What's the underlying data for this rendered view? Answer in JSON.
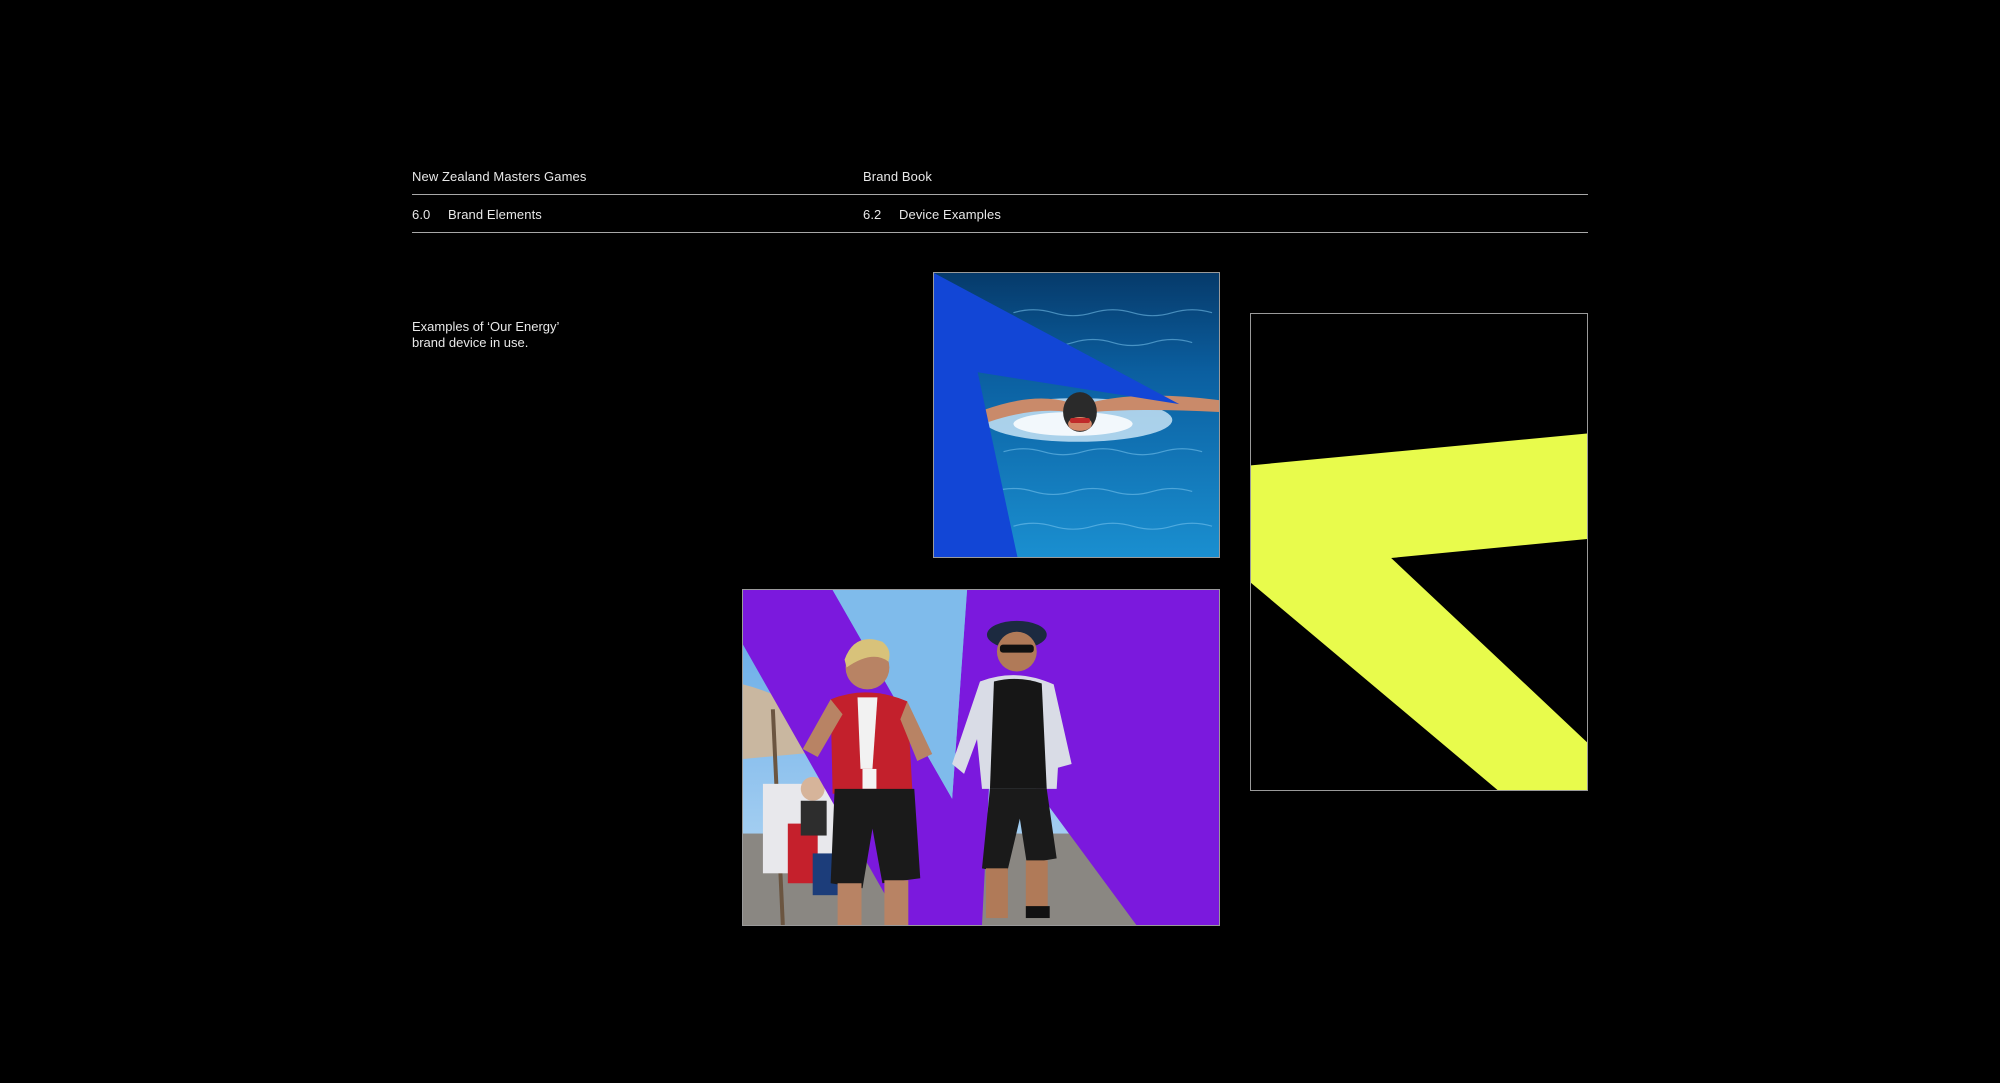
{
  "header": {
    "org_name": "New Zealand Masters Games",
    "doc_title": "Brand Book",
    "section_number": "6.0",
    "section_title": "Brand Elements",
    "subsection_number": "6.2",
    "subsection_title": "Device Examples"
  },
  "intro": {
    "line1": "Examples of ‘Our Energy’",
    "line2": "brand device in use."
  },
  "colors": {
    "background": "#000000",
    "device_blue": "#1246d6",
    "device_purple": "#7b19dd",
    "device_lime": "#e8fb4c",
    "pool_water": "#0a6fb8",
    "sky": "#8fc3ee"
  },
  "images": {
    "swimmer_photo": "swimmer-photo-with-blue-device",
    "runners_photo": "runners-photo-with-purple-device",
    "device_graphic": "lime-chevron-device-on-black"
  }
}
